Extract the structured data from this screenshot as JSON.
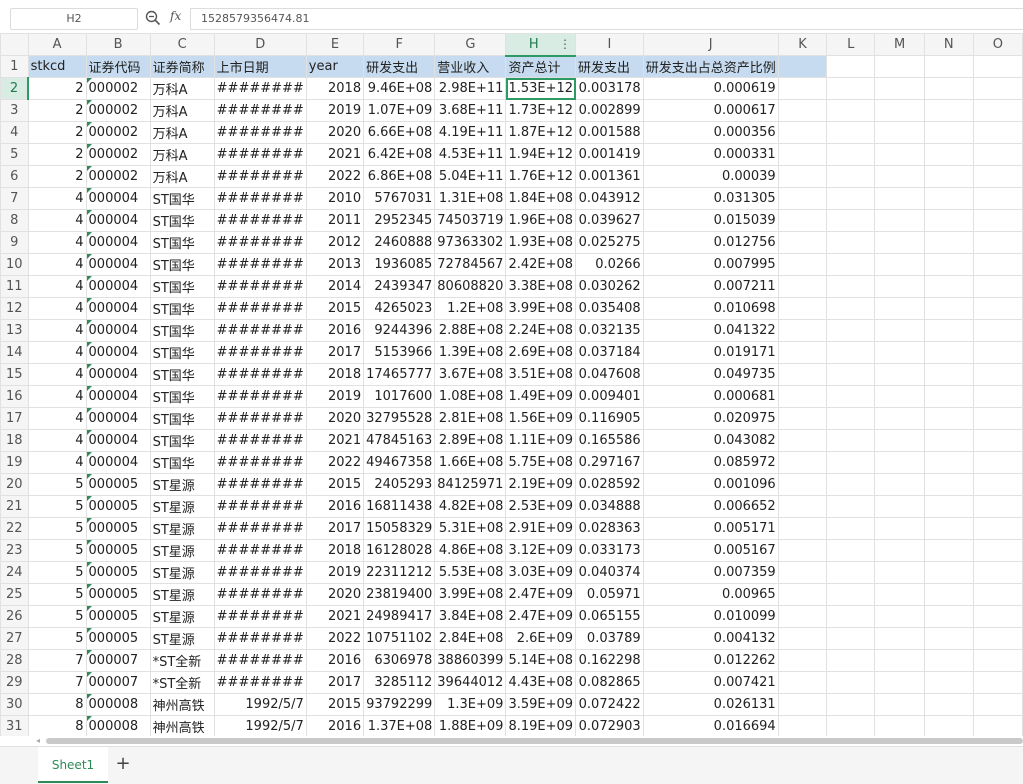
{
  "formula_bar": {
    "cell_ref": "H2",
    "fx": "fx",
    "value": "1528579356474.81"
  },
  "columns": [
    "A",
    "B",
    "C",
    "D",
    "E",
    "F",
    "G",
    "H",
    "I",
    "J",
    "K",
    "L",
    "M",
    "N",
    "O"
  ],
  "active_column": "H",
  "active_row": 2,
  "header_row": [
    "stkcd",
    "证券代码",
    "证券简称",
    "上市日期",
    "year",
    "研发支出",
    "营业收入",
    "资产总计",
    "研发支出",
    "研发支出占总资产比例"
  ],
  "rows": [
    [
      "2",
      "000002",
      "万科A",
      "########",
      "2018",
      "9.46E+08",
      "2.98E+11",
      "1.53E+12",
      "0.003178",
      "0.000619"
    ],
    [
      "2",
      "000002",
      "万科A",
      "########",
      "2019",
      "1.07E+09",
      "3.68E+11",
      "1.73E+12",
      "0.002899",
      "0.000617"
    ],
    [
      "2",
      "000002",
      "万科A",
      "########",
      "2020",
      "6.66E+08",
      "4.19E+11",
      "1.87E+12",
      "0.001588",
      "0.000356"
    ],
    [
      "2",
      "000002",
      "万科A",
      "########",
      "2021",
      "6.42E+08",
      "4.53E+11",
      "1.94E+12",
      "0.001419",
      "0.000331"
    ],
    [
      "2",
      "000002",
      "万科A",
      "########",
      "2022",
      "6.86E+08",
      "5.04E+11",
      "1.76E+12",
      "0.001361",
      "0.00039"
    ],
    [
      "4",
      "000004",
      "ST国华",
      "########",
      "2010",
      "5767031",
      "1.31E+08",
      "1.84E+08",
      "0.043912",
      "0.031305"
    ],
    [
      "4",
      "000004",
      "ST国华",
      "########",
      "2011",
      "2952345",
      "74503719",
      "1.96E+08",
      "0.039627",
      "0.015039"
    ],
    [
      "4",
      "000004",
      "ST国华",
      "########",
      "2012",
      "2460888",
      "97363302",
      "1.93E+08",
      "0.025275",
      "0.012756"
    ],
    [
      "4",
      "000004",
      "ST国华",
      "########",
      "2013",
      "1936085",
      "72784567",
      "2.42E+08",
      "0.0266",
      "0.007995"
    ],
    [
      "4",
      "000004",
      "ST国华",
      "########",
      "2014",
      "2439347",
      "80608820",
      "3.38E+08",
      "0.030262",
      "0.007211"
    ],
    [
      "4",
      "000004",
      "ST国华",
      "########",
      "2015",
      "4265023",
      "1.2E+08",
      "3.99E+08",
      "0.035408",
      "0.010698"
    ],
    [
      "4",
      "000004",
      "ST国华",
      "########",
      "2016",
      "9244396",
      "2.88E+08",
      "2.24E+08",
      "0.032135",
      "0.041322"
    ],
    [
      "4",
      "000004",
      "ST国华",
      "########",
      "2017",
      "5153966",
      "1.39E+08",
      "2.69E+08",
      "0.037184",
      "0.019171"
    ],
    [
      "4",
      "000004",
      "ST国华",
      "########",
      "2018",
      "17465777",
      "3.67E+08",
      "3.51E+08",
      "0.047608",
      "0.049735"
    ],
    [
      "4",
      "000004",
      "ST国华",
      "########",
      "2019",
      "1017600",
      "1.08E+08",
      "1.49E+09",
      "0.009401",
      "0.000681"
    ],
    [
      "4",
      "000004",
      "ST国华",
      "########",
      "2020",
      "32795528",
      "2.81E+08",
      "1.56E+09",
      "0.116905",
      "0.020975"
    ],
    [
      "4",
      "000004",
      "ST国华",
      "########",
      "2021",
      "47845163",
      "2.89E+08",
      "1.11E+09",
      "0.165586",
      "0.043082"
    ],
    [
      "4",
      "000004",
      "ST国华",
      "########",
      "2022",
      "49467358",
      "1.66E+08",
      "5.75E+08",
      "0.297167",
      "0.085972"
    ],
    [
      "5",
      "000005",
      "ST星源",
      "########",
      "2015",
      "2405293",
      "84125971",
      "2.19E+09",
      "0.028592",
      "0.001096"
    ],
    [
      "5",
      "000005",
      "ST星源",
      "########",
      "2016",
      "16811438",
      "4.82E+08",
      "2.53E+09",
      "0.034888",
      "0.006652"
    ],
    [
      "5",
      "000005",
      "ST星源",
      "########",
      "2017",
      "15058329",
      "5.31E+08",
      "2.91E+09",
      "0.028363",
      "0.005171"
    ],
    [
      "5",
      "000005",
      "ST星源",
      "########",
      "2018",
      "16128028",
      "4.86E+08",
      "3.12E+09",
      "0.033173",
      "0.005167"
    ],
    [
      "5",
      "000005",
      "ST星源",
      "########",
      "2019",
      "22311212",
      "5.53E+08",
      "3.03E+09",
      "0.040374",
      "0.007359"
    ],
    [
      "5",
      "000005",
      "ST星源",
      "########",
      "2020",
      "23819400",
      "3.99E+08",
      "2.47E+09",
      "0.05971",
      "0.00965"
    ],
    [
      "5",
      "000005",
      "ST星源",
      "########",
      "2021",
      "24989417",
      "3.84E+08",
      "2.47E+09",
      "0.065155",
      "0.010099"
    ],
    [
      "5",
      "000005",
      "ST星源",
      "########",
      "2022",
      "10751102",
      "2.84E+08",
      "2.6E+09",
      "0.03789",
      "0.004132"
    ],
    [
      "7",
      "000007",
      "*ST全新",
      "########",
      "2016",
      "6306978",
      "38860399",
      "5.14E+08",
      "0.162298",
      "0.012262"
    ],
    [
      "7",
      "000007",
      "*ST全新",
      "########",
      "2017",
      "3285112",
      "39644012",
      "4.43E+08",
      "0.082865",
      "0.007421"
    ],
    [
      "8",
      "000008",
      "神州高铁",
      "1992/5/7",
      "2015",
      "93792299",
      "1.3E+09",
      "3.59E+09",
      "0.072422",
      "0.026131"
    ],
    [
      "8",
      "000008",
      "神州高铁",
      "1992/5/7",
      "2016",
      "1.37E+08",
      "1.88E+09",
      "8.19E+09",
      "0.072903",
      "0.016694"
    ]
  ],
  "sheet_tabs": [
    "Sheet1"
  ],
  "add_sheet": "+"
}
